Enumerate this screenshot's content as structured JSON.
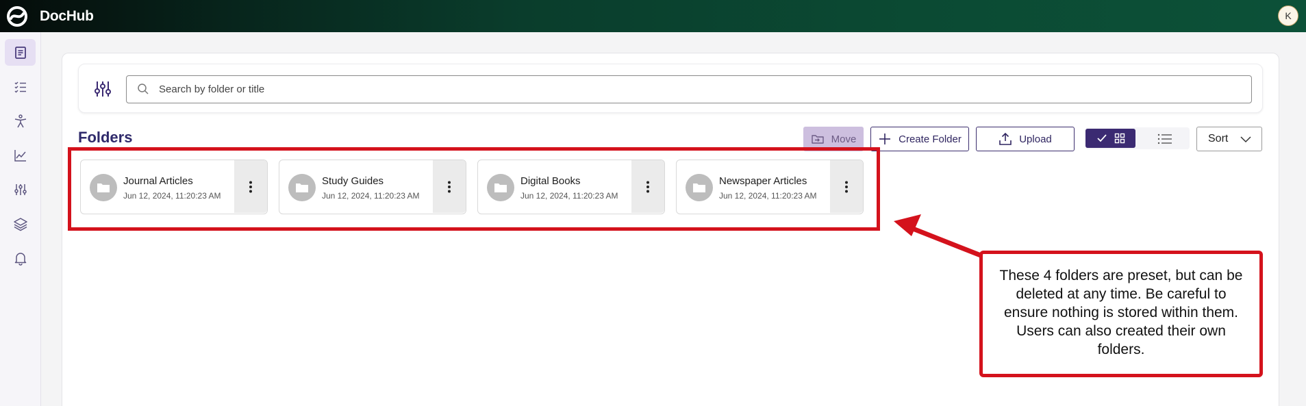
{
  "app": {
    "brand": "DocHub",
    "user_initial": "K"
  },
  "sidebar": {
    "items": [
      {
        "name": "documents",
        "icon": "document-icon",
        "active": true
      },
      {
        "name": "checklist",
        "icon": "checklist-icon",
        "active": false
      },
      {
        "name": "accessibility",
        "icon": "person-icon",
        "active": false
      },
      {
        "name": "analytics",
        "icon": "line-chart-icon",
        "active": false
      },
      {
        "name": "settings",
        "icon": "sliders-icon",
        "active": false
      },
      {
        "name": "layers",
        "icon": "layers-icon",
        "active": false
      },
      {
        "name": "notifications",
        "icon": "bell-icon",
        "active": false
      }
    ]
  },
  "search": {
    "placeholder": "Search by folder or title",
    "value": ""
  },
  "section": {
    "title": "Folders"
  },
  "toolbar": {
    "move_label": "Move",
    "create_label": "Create Folder",
    "upload_label": "Upload",
    "sort_label": "Sort",
    "view_mode": "grid"
  },
  "folders": [
    {
      "name": "Journal Articles",
      "date": "Jun 12, 2024, 11:20:23 AM"
    },
    {
      "name": "Study Guides",
      "date": "Jun 12, 2024, 11:20:23 AM"
    },
    {
      "name": "Digital Books",
      "date": "Jun 12, 2024, 11:20:23 AM"
    },
    {
      "name": "Newspaper Articles",
      "date": "Jun 12, 2024, 11:20:23 AM"
    }
  ],
  "annotation": {
    "text": "These 4 folders are preset, but can be deleted at any time. Be careful to ensure nothing is stored within them. Users can also created their own folders.",
    "color": "#d4121c"
  },
  "colors": {
    "brand_dark": "#3b2a72",
    "topbar": "#0b4a33"
  }
}
